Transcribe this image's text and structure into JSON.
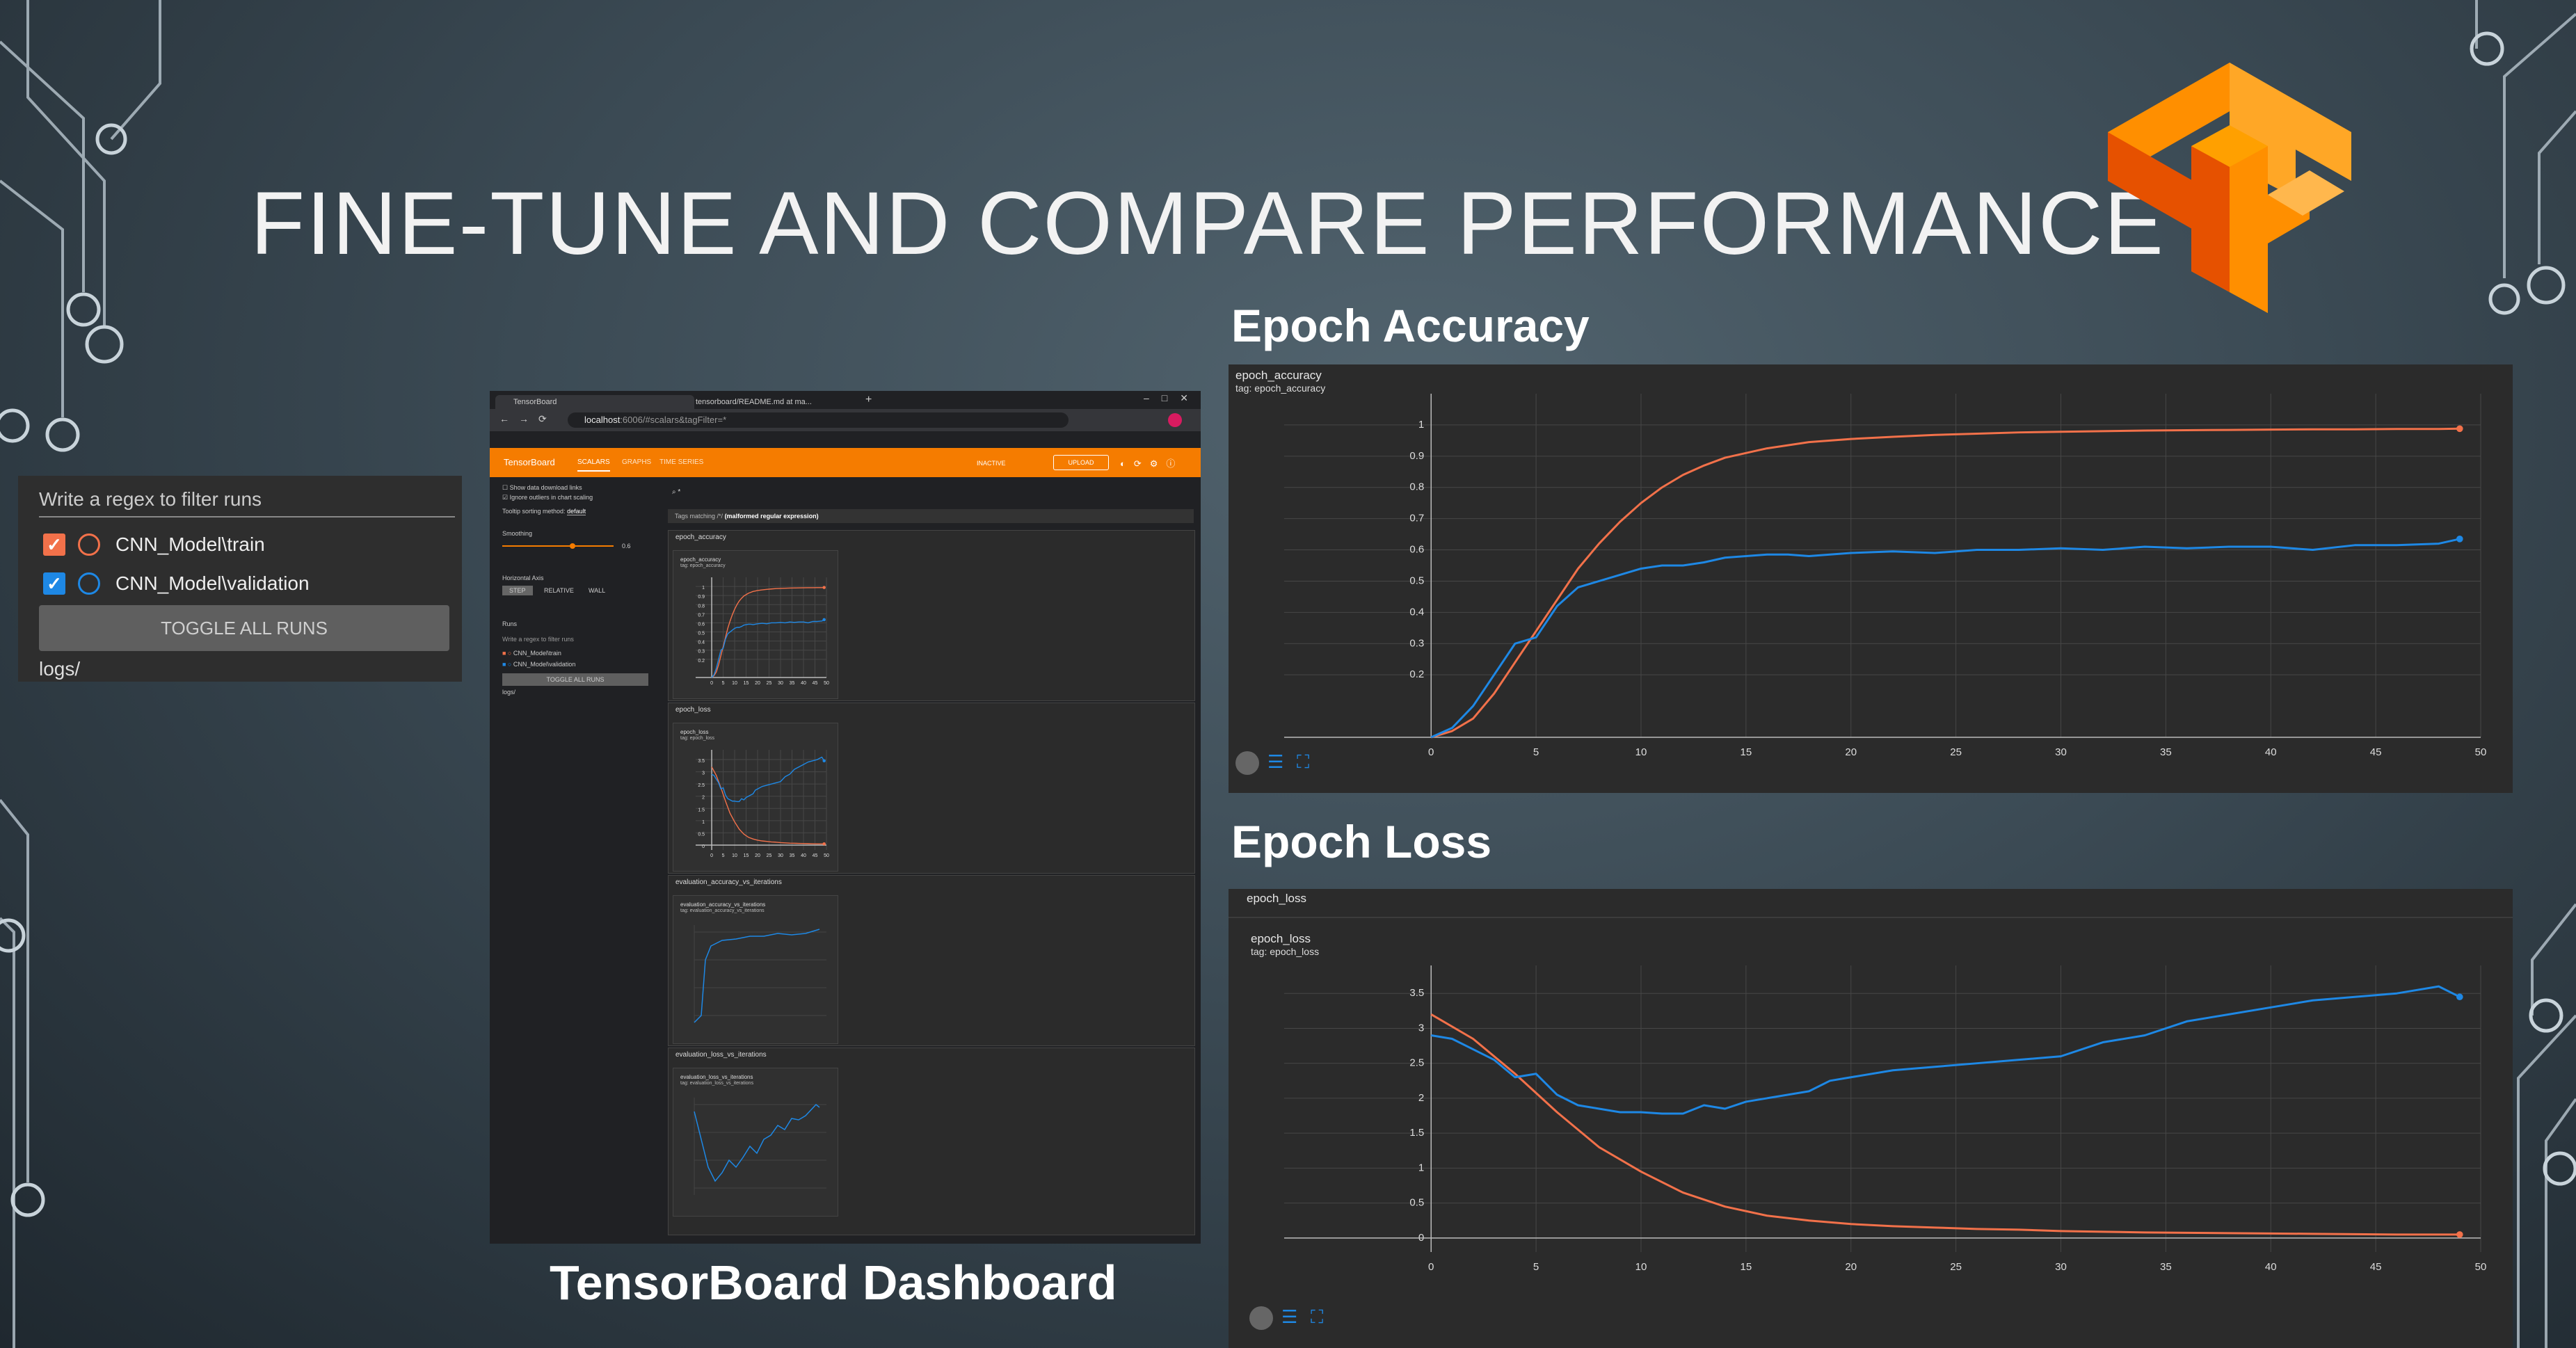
{
  "slide": {
    "title": "FINE-TUNE AND COMPARE PERFORMANCE",
    "caption_accuracy": "Epoch Accuracy",
    "caption_loss": "Epoch Loss",
    "caption_dashboard": "TensorBoard Dashboard"
  },
  "runs_panel": {
    "filter_placeholder": "Write a regex to filter runs",
    "runs": [
      {
        "label": "CNN_Model\\train",
        "color": "#f2714a",
        "checked": true
      },
      {
        "label": "CNN_Model\\validation",
        "color": "#1e88e5",
        "checked": true
      }
    ],
    "toggle_label": "TOGGLE ALL RUNS",
    "logdir": "logs/"
  },
  "browser": {
    "tabs": [
      {
        "label": "TensorBoard"
      },
      {
        "label": "tensorboard/README.md at ma..."
      }
    ],
    "url_host": "localhost",
    "url_rest": ":6006/#scalars&tagFilter=*",
    "brand": "TensorBoard",
    "nav": [
      "SCALARS",
      "GRAPHS",
      "TIME SERIES"
    ],
    "status": "INACTIVE",
    "upload": "UPLOAD",
    "sidebar": {
      "show_download": "Show data download links",
      "ignore_outliers": "Ignore outliers in chart scaling",
      "tooltip_label": "Tooltip sorting method:",
      "tooltip_value": "default",
      "smoothing_label": "Smoothing",
      "smoothing_value": "0.6",
      "axis_label": "Horizontal Axis",
      "axis_options": [
        "STEP",
        "RELATIVE",
        "WALL"
      ],
      "runs_label": "Runs",
      "filter_placeholder": "Write a regex to filter runs",
      "runs": [
        "CNN_Model\\train",
        "CNN_Model\\validation"
      ],
      "toggle": "TOGGLE ALL RUNS",
      "logdir": "logs/"
    },
    "search_value": "*",
    "tag_matching": "Tags matching /*/",
    "tag_matching_note": "(malformed regular expression)",
    "panels": [
      {
        "name": "epoch_accuracy",
        "chart_title": "epoch_accuracy",
        "tag": "tag: epoch_accuracy"
      },
      {
        "name": "epoch_loss",
        "chart_title": "epoch_loss",
        "tag": "tag: epoch_loss"
      },
      {
        "name": "evaluation_accuracy_vs_iterations",
        "chart_title": "evaluation_accuracy_vs_iterations",
        "tag": "tag: evaluation_accuracy_vs_iterations"
      },
      {
        "name": "evaluation_loss_vs_iterations",
        "chart_title": "evaluation_loss_vs_iterations",
        "tag": "tag: evaluation_loss_vs_iterations"
      }
    ]
  },
  "accuracy_chart": {
    "title": "epoch_accuracy",
    "tag": "tag: epoch_accuracy"
  },
  "loss_chart": {
    "section": "epoch_loss",
    "title": "epoch_loss",
    "tag": "tag: epoch_loss"
  },
  "chart_data": [
    {
      "type": "line",
      "title": "epoch_accuracy",
      "xlim": [
        -7,
        50
      ],
      "ylim": [
        0,
        1.1
      ],
      "xticks": [
        0,
        5,
        10,
        15,
        20,
        25,
        30,
        35,
        40,
        45,
        50
      ],
      "yticks": [
        0.2,
        0.3,
        0.4,
        0.5,
        0.6,
        0.7,
        0.8,
        0.9,
        1
      ],
      "grid": true,
      "series": [
        {
          "name": "CNN_Model\\train",
          "color": "#f2714a",
          "x": [
            0,
            1,
            2,
            3,
            4,
            5,
            6,
            7,
            8,
            9,
            10,
            11,
            12,
            13,
            14,
            15,
            16,
            17,
            18,
            19,
            20,
            22,
            24,
            26,
            28,
            30,
            32,
            34,
            36,
            38,
            40,
            42,
            44,
            46,
            48,
            49
          ],
          "y": [
            0.0,
            0.02,
            0.06,
            0.14,
            0.24,
            0.34,
            0.44,
            0.54,
            0.62,
            0.69,
            0.75,
            0.8,
            0.84,
            0.87,
            0.895,
            0.91,
            0.925,
            0.935,
            0.945,
            0.95,
            0.955,
            0.962,
            0.968,
            0.972,
            0.976,
            0.978,
            0.98,
            0.982,
            0.983,
            0.984,
            0.985,
            0.986,
            0.986,
            0.987,
            0.987,
            0.988
          ]
        },
        {
          "name": "CNN_Model\\validation",
          "color": "#1e88e5",
          "x": [
            0,
            1,
            2,
            3,
            4,
            5,
            6,
            7,
            8,
            9,
            10,
            11,
            12,
            13,
            14,
            15,
            16,
            17,
            18,
            19,
            20,
            22,
            24,
            26,
            28,
            30,
            32,
            34,
            36,
            38,
            40,
            42,
            44,
            46,
            48,
            49
          ],
          "y": [
            0.0,
            0.03,
            0.1,
            0.2,
            0.3,
            0.32,
            0.42,
            0.48,
            0.5,
            0.52,
            0.54,
            0.55,
            0.55,
            0.56,
            0.575,
            0.58,
            0.585,
            0.585,
            0.58,
            0.585,
            0.59,
            0.595,
            0.59,
            0.6,
            0.6,
            0.605,
            0.6,
            0.61,
            0.605,
            0.61,
            0.61,
            0.6,
            0.615,
            0.615,
            0.62,
            0.635
          ]
        }
      ]
    },
    {
      "type": "line",
      "title": "epoch_loss",
      "xlim": [
        -7,
        50
      ],
      "ylim": [
        -0.2,
        3.9
      ],
      "xticks": [
        0,
        5,
        10,
        15,
        20,
        25,
        30,
        35,
        40,
        45,
        50
      ],
      "yticks": [
        0,
        0.5,
        1,
        1.5,
        2,
        2.5,
        3,
        3.5
      ],
      "grid": true,
      "series": [
        {
          "name": "CNN_Model\\train",
          "color": "#f2714a",
          "x": [
            0,
            2,
            4,
            6,
            8,
            10,
            12,
            14,
            16,
            18,
            20,
            22,
            24,
            26,
            28,
            30,
            32,
            34,
            36,
            38,
            40,
            42,
            44,
            46,
            48,
            49
          ],
          "y": [
            3.2,
            2.85,
            2.35,
            1.8,
            1.3,
            0.95,
            0.65,
            0.45,
            0.32,
            0.25,
            0.2,
            0.17,
            0.15,
            0.13,
            0.12,
            0.1,
            0.09,
            0.08,
            0.075,
            0.07,
            0.065,
            0.06,
            0.055,
            0.05,
            0.05,
            0.05
          ]
        },
        {
          "name": "CNN_Model\\validation",
          "color": "#1e88e5",
          "x": [
            0,
            1,
            2,
            3,
            4,
            5,
            6,
            7,
            8,
            9,
            10,
            11,
            12,
            13,
            14,
            15,
            16,
            17,
            18,
            19,
            20,
            22,
            24,
            26,
            28,
            30,
            32,
            34,
            36,
            38,
            40,
            42,
            44,
            46,
            48,
            49
          ],
          "y": [
            2.9,
            2.85,
            2.7,
            2.55,
            2.3,
            2.35,
            2.05,
            1.9,
            1.85,
            1.8,
            1.8,
            1.78,
            1.78,
            1.9,
            1.85,
            1.95,
            2.0,
            2.05,
            2.1,
            2.25,
            2.3,
            2.4,
            2.45,
            2.5,
            2.55,
            2.6,
            2.8,
            2.9,
            3.1,
            3.2,
            3.3,
            3.4,
            3.45,
            3.5,
            3.6,
            3.45
          ]
        }
      ]
    }
  ]
}
